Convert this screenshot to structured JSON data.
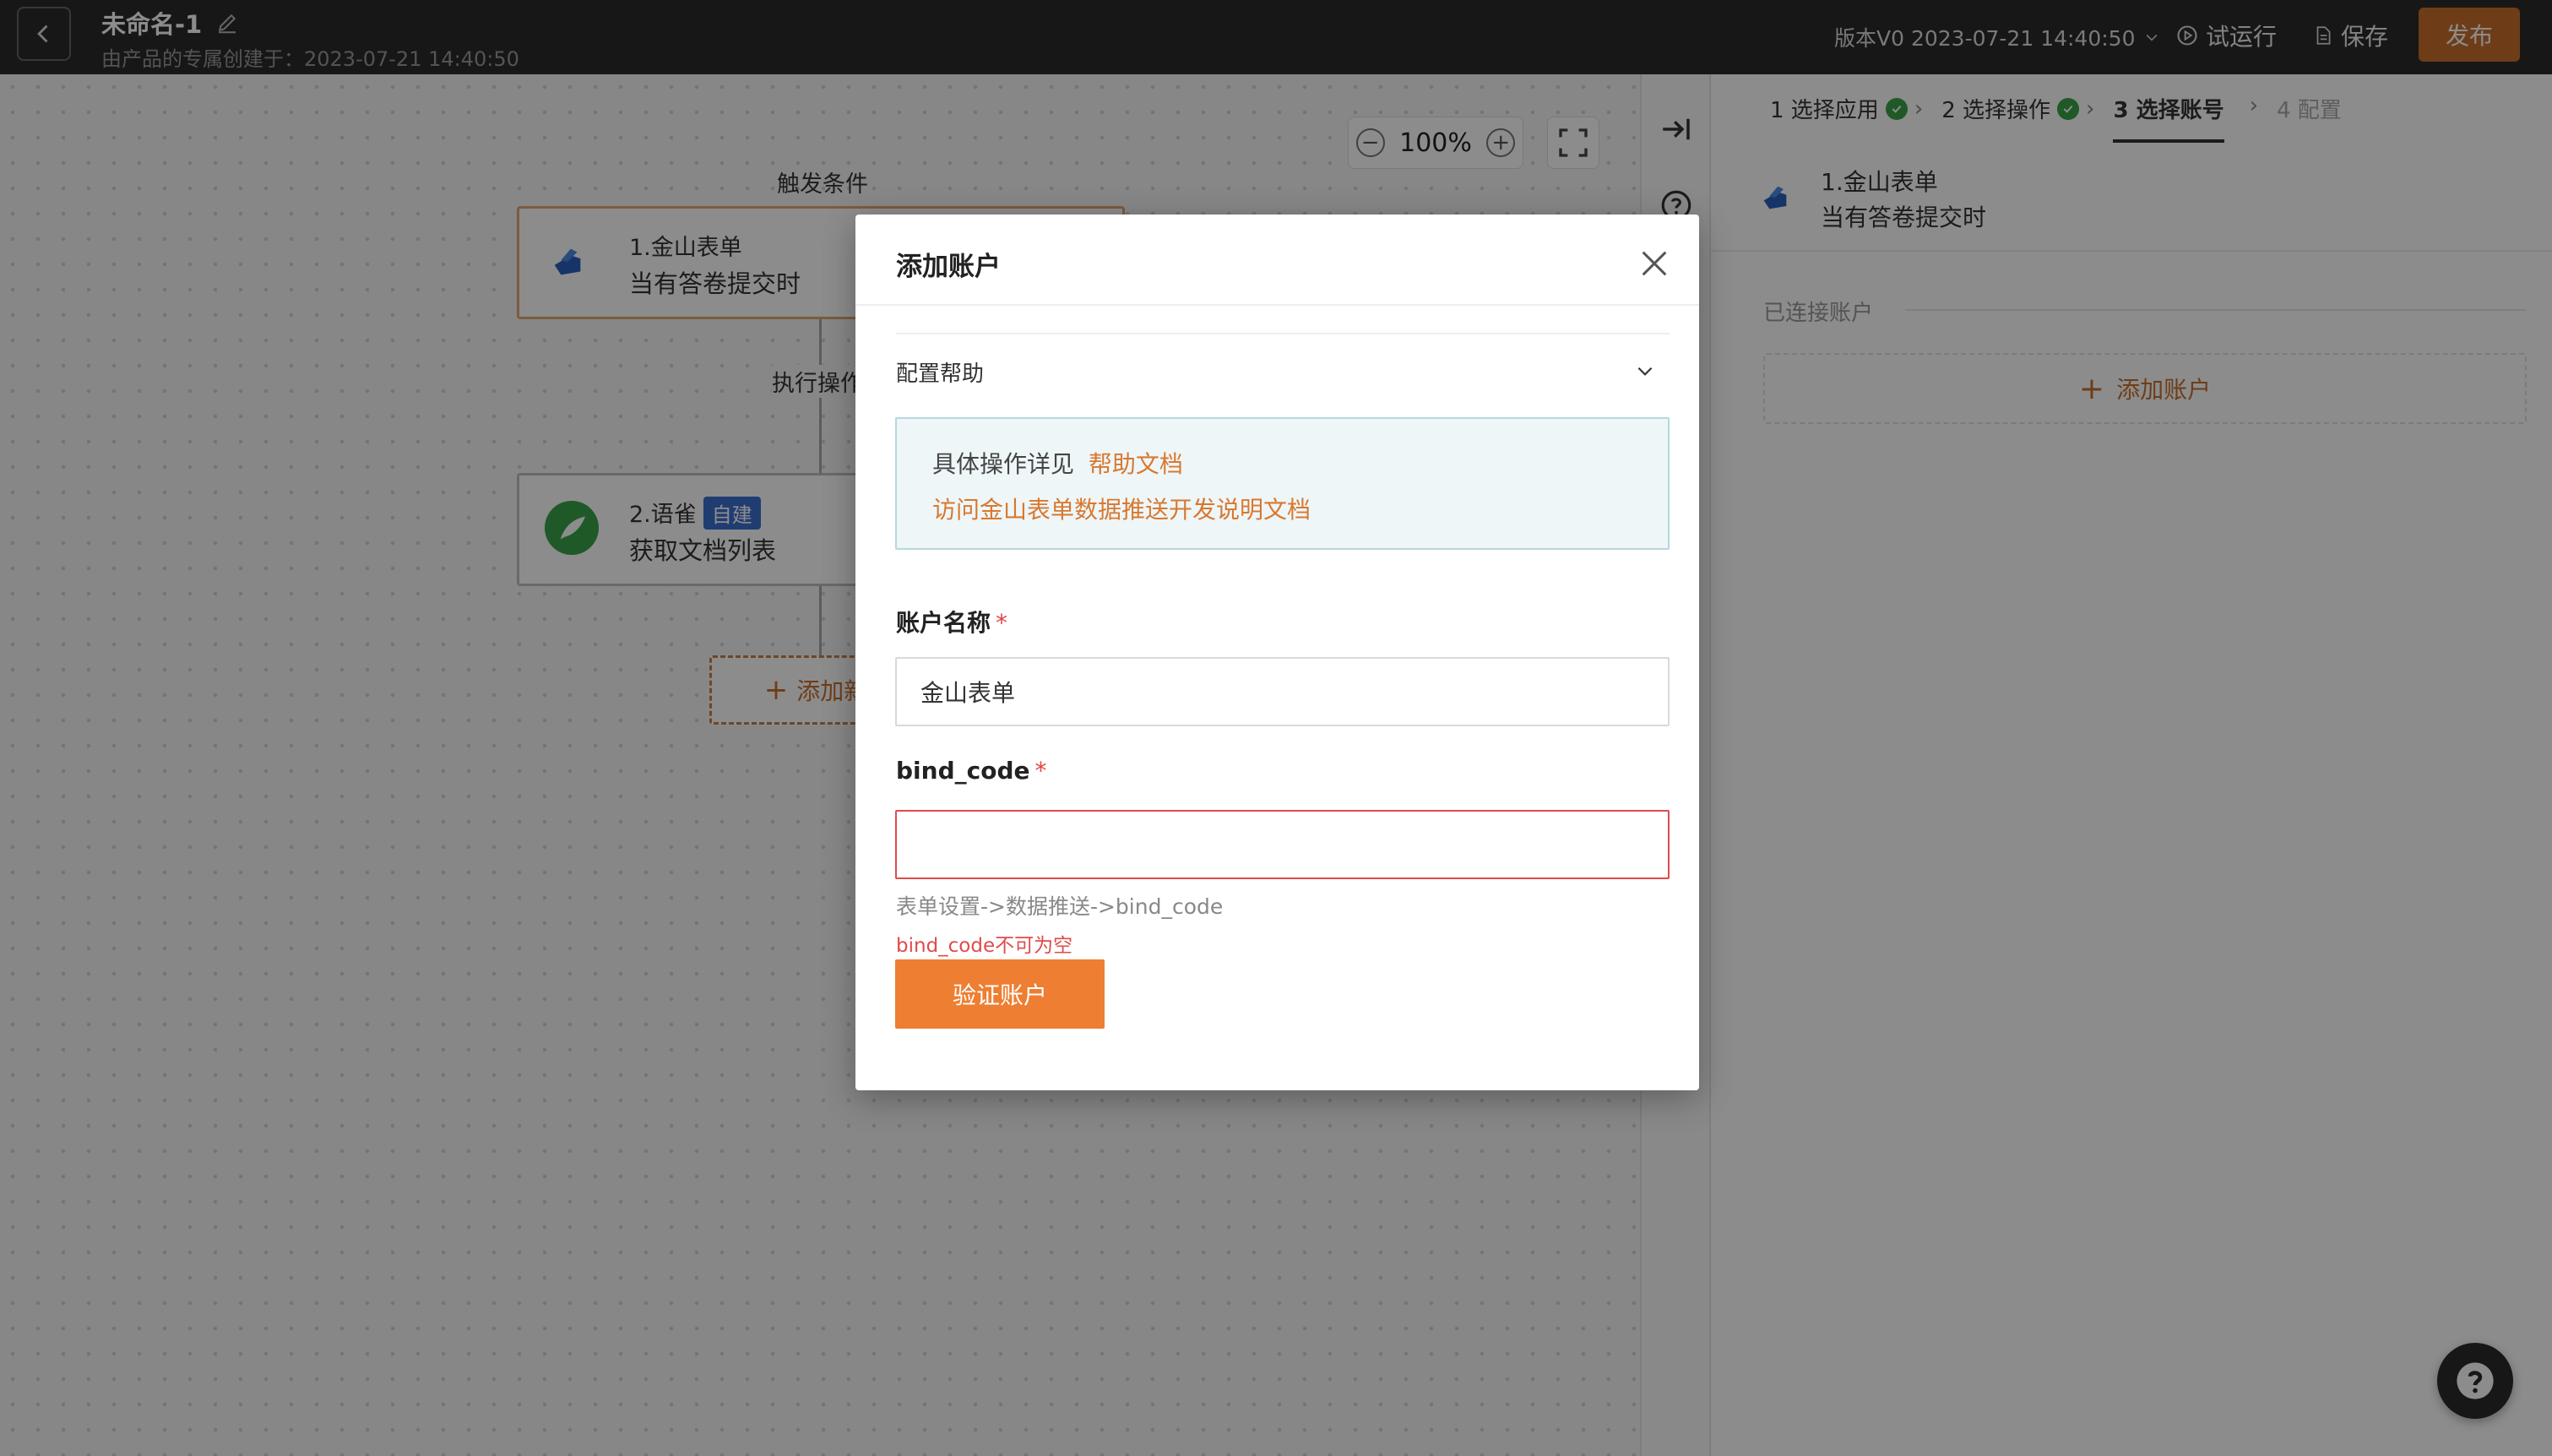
{
  "header": {
    "title": "未命名-1",
    "subtitle": "由产品的专属创建于：2023-07-21 14:40:50",
    "version": "版本V0 2023-07-21 14:40:50",
    "trial_run": "试运行",
    "save": "保存",
    "publish": "发布"
  },
  "canvas": {
    "zoom": "100%",
    "trigger_label": "触发条件",
    "action_label": "执行操作",
    "node1": {
      "title": "1.金山表单",
      "subtitle": "当有答卷提交时"
    },
    "node2": {
      "title": "2.语雀",
      "badge": "自建",
      "subtitle": "获取文档列表"
    },
    "add_step": "添加新步"
  },
  "panel": {
    "steps": [
      {
        "label": "1 选择应用"
      },
      {
        "label": "2 选择操作"
      },
      {
        "label": "3 选择账号"
      },
      {
        "label": "4 配置"
      }
    ],
    "app_title": "1.金山表单",
    "app_subtitle": "当有答卷提交时",
    "connected_label": "已连接账户",
    "add_account": "添加账户"
  },
  "modal": {
    "title": "添加账户",
    "help_section": "配置帮助",
    "help_text_prefix": "具体操作详见",
    "help_link": "帮助文档",
    "help_dev_link": "访问金山表单数据推送开发说明文档",
    "account_name_label": "账户名称",
    "account_name_value": "金山表单",
    "bind_code_label": "bind_code",
    "bind_code_value": "",
    "bind_code_hint": "表单设置->数据推送->bind_code",
    "bind_code_error": "bind_code不可为空",
    "verify_button": "验证账户"
  },
  "colors": {
    "accent": "#ee7e31",
    "topbar": "#2b2b2b",
    "error": "#e04b4b",
    "success": "#3aa34a"
  }
}
